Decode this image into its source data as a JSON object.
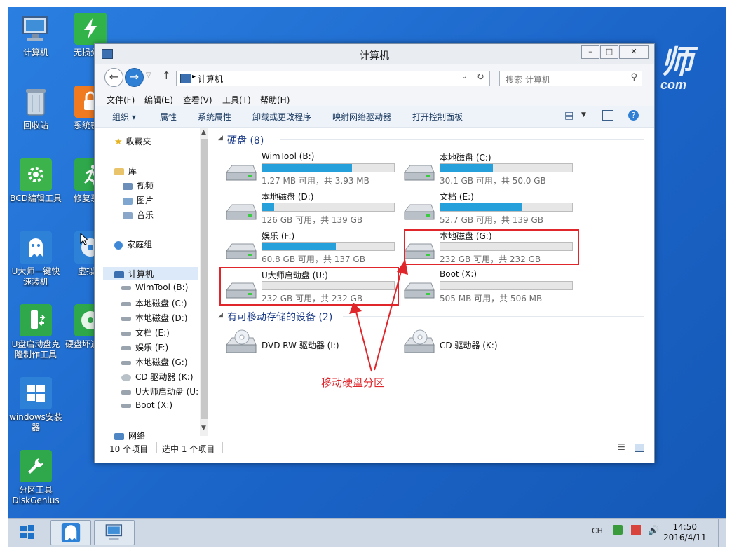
{
  "desktop": {
    "brand_big": "师",
    "brand_small": "com",
    "icons": [
      {
        "label": "计算机"
      },
      {
        "label": "无损分区"
      },
      {
        "label": "回收站"
      },
      {
        "label": "系统密码"
      },
      {
        "label": "BCD编辑工具"
      },
      {
        "label": "修复系统"
      },
      {
        "label": "U大师一键快速装机"
      },
      {
        "label": "虚拟光"
      },
      {
        "label": "U盘启动盘克隆制作工具"
      },
      {
        "label": "硬盘坏道工具"
      },
      {
        "label": "windows安装器"
      },
      {
        "label": "分区工具DiskGenius"
      }
    ]
  },
  "window": {
    "title": "计算机",
    "address_path": "计算机",
    "search_placeholder": "搜索 计算机",
    "menu": [
      "文件(F)",
      "编辑(E)",
      "查看(V)",
      "工具(T)",
      "帮助(H)"
    ],
    "commands": [
      "组织 ▾",
      "属性",
      "系统属性",
      "卸载或更改程序",
      "映射网络驱动器",
      "打开控制面板"
    ],
    "nav": {
      "favorites": "收藏夹",
      "libraries": "库",
      "lib_items": [
        "视频",
        "图片",
        "音乐"
      ],
      "homegroup": "家庭组",
      "computer": "计算机",
      "drives": [
        "WimTool (B:)",
        "本地磁盘 (C:)",
        "本地磁盘 (D:)",
        "文档 (E:)",
        "娱乐 (F:)",
        "本地磁盘 (G:)",
        "CD 驱动器 (K:)",
        "U大师启动盘 (U:",
        "Boot (X:)"
      ],
      "network": "网络"
    },
    "groups": {
      "hard_disks": "硬盘 (8)",
      "removable": "有可移动存储的设备 (2)"
    },
    "drives": [
      {
        "name": "WimTool (B:)",
        "free": "1.27 MB 可用，共 3.93 MB",
        "used_fraction": 0.68
      },
      {
        "name": "本地磁盘 (C:)",
        "free": "30.1 GB 可用，共 50.0 GB",
        "used_fraction": 0.4
      },
      {
        "name": "本地磁盘 (D:)",
        "free": "126 GB 可用，共 139 GB",
        "used_fraction": 0.09
      },
      {
        "name": "文档 (E:)",
        "free": "52.7 GB 可用，共 139 GB",
        "used_fraction": 0.62
      },
      {
        "name": "娱乐 (F:)",
        "free": "60.8 GB 可用，共 137 GB",
        "used_fraction": 0.56
      },
      {
        "name": "本地磁盘 (G:)",
        "free": "232 GB 可用，共 232 GB",
        "used_fraction": 0.0
      },
      {
        "name": "U大师启动盘 (U:)",
        "free": "232 GB 可用，共 232 GB",
        "used_fraction": 0.0
      },
      {
        "name": "Boot (X:)",
        "free": "505 MB 可用，共 506 MB",
        "used_fraction": 0.0
      }
    ],
    "removable_devices": [
      {
        "name": "DVD RW 驱动器 (I:)"
      },
      {
        "name": "CD 驱动器 (K:)"
      }
    ],
    "status": {
      "item_count": "10 个项目",
      "selected": "选中 1 个项目"
    }
  },
  "annotation": "移动硬盘分区",
  "taskbar": {
    "lang": "CH",
    "time": "14:50",
    "date": "2016/4/11"
  },
  "colors": {
    "bar_fill": "#26a0da",
    "highlight": "#e0262b",
    "desktop": "#1f6fd1"
  }
}
